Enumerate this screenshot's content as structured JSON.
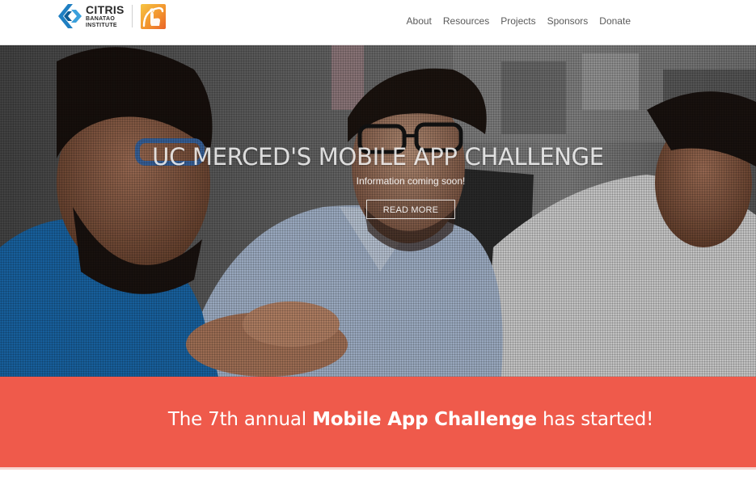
{
  "header": {
    "logo": {
      "main": "CITRIS",
      "sub1": "BANATAO",
      "sub2": "INSTITUTE",
      "icon": "citris-chevron-logo"
    },
    "app_logo_icon": "tap-hand-icon",
    "nav": [
      "About",
      "Resources",
      "Projects",
      "Sponsors",
      "Donate"
    ]
  },
  "hero": {
    "title": "UC MERCED'S MOBILE APP CHALLENGE",
    "subtitle": "Information coming soon!",
    "button": "READ MORE"
  },
  "banner": {
    "prefix": "The 7th annual ",
    "highlight": "Mobile App Challenge",
    "suffix": " has started!"
  },
  "colors": {
    "banner": "#ef5a4b",
    "logo_blue": "#1f7fc2",
    "logo_orange": "#f2902c"
  }
}
